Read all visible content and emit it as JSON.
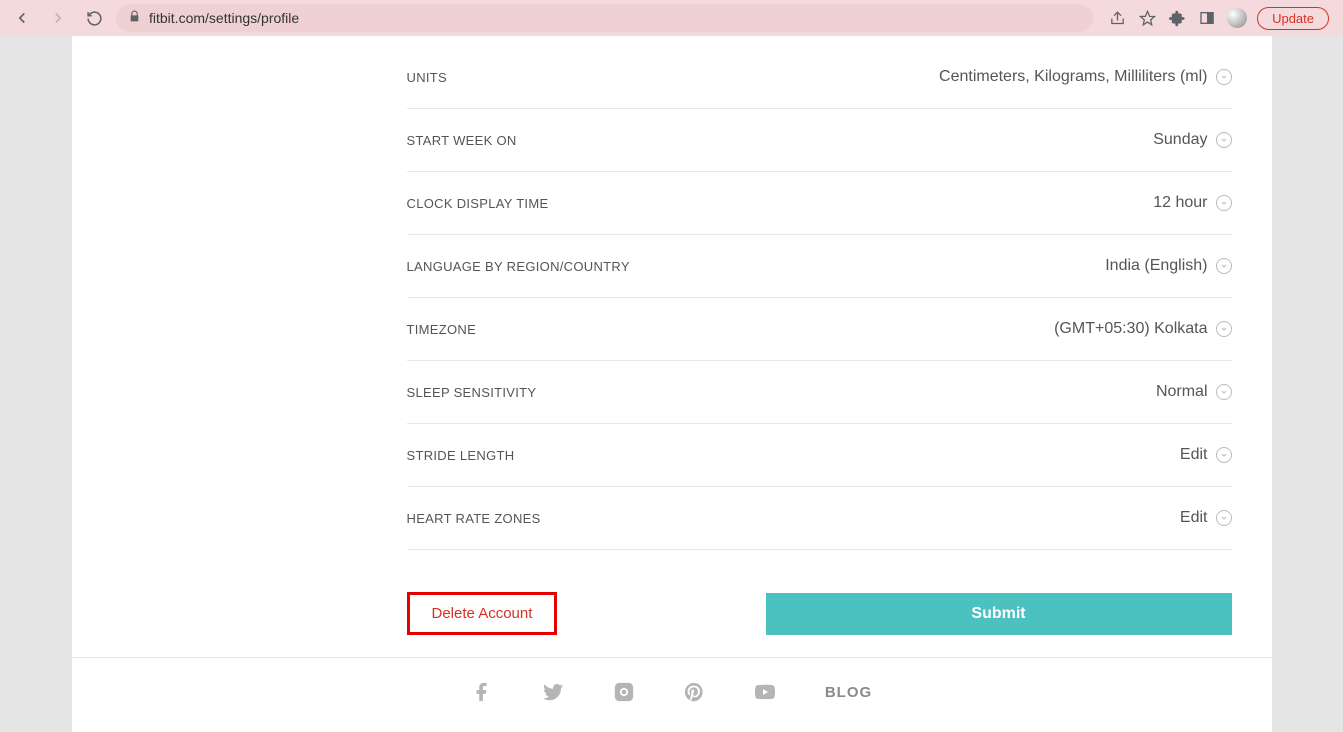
{
  "browser": {
    "url": "fitbit.com/settings/profile",
    "update_label": "Update"
  },
  "settings": [
    {
      "label": "UNITS",
      "value": "Centimeters, Kilograms, Milliliters (ml)"
    },
    {
      "label": "START WEEK ON",
      "value": "Sunday"
    },
    {
      "label": "CLOCK DISPLAY TIME",
      "value": "12 hour"
    },
    {
      "label": "LANGUAGE BY REGION/COUNTRY",
      "value": "India (English)"
    },
    {
      "label": "TIMEZONE",
      "value": "(GMT+05:30) Kolkata"
    },
    {
      "label": "SLEEP SENSITIVITY",
      "value": "Normal"
    },
    {
      "label": "STRIDE LENGTH",
      "value": "Edit"
    },
    {
      "label": "HEART RATE ZONES",
      "value": "Edit"
    }
  ],
  "actions": {
    "delete_label": "Delete Account",
    "submit_label": "Submit"
  },
  "footer": {
    "blog_label": "BLOG"
  }
}
